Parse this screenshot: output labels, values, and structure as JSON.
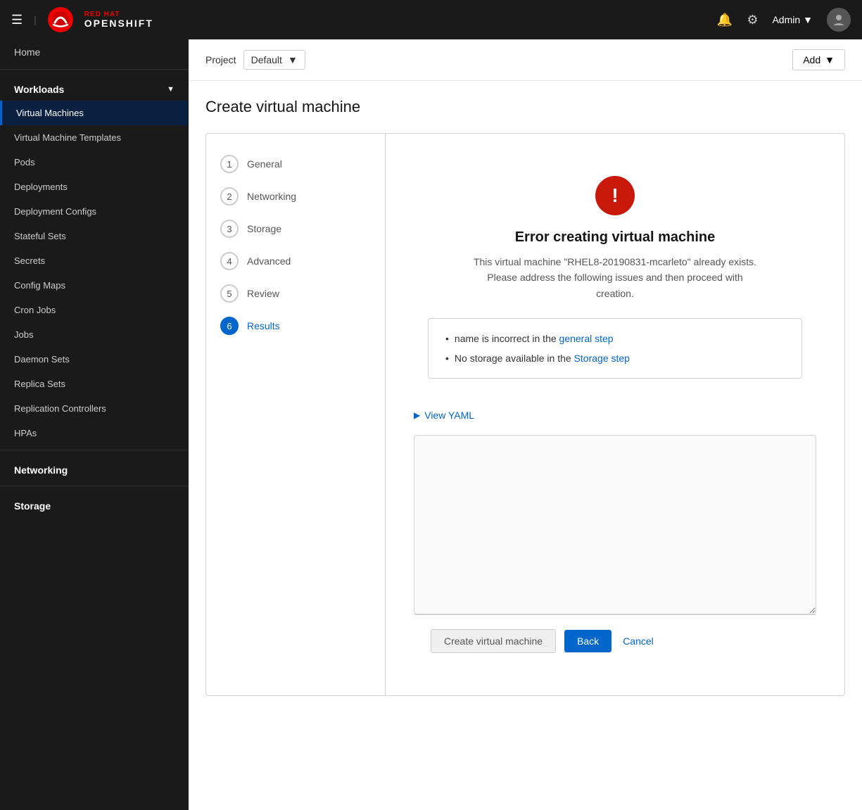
{
  "topNav": {
    "brandName": "OPENSHIFT",
    "adminLabel": "Admin",
    "notificationIcon": "🔔",
    "settingsIcon": "⚙"
  },
  "sidebar": {
    "homeLabel": "Home",
    "workloadsLabel": "Workloads",
    "networkingLabel": "Networking",
    "storageLabel": "Storage",
    "workloadsItems": [
      {
        "label": "Virtual Machines",
        "active": true
      },
      {
        "label": "Virtual Machine Templates",
        "active": false
      },
      {
        "label": "Pods",
        "active": false
      },
      {
        "label": "Deployments",
        "active": false
      },
      {
        "label": "Deployment Configs",
        "active": false
      },
      {
        "label": "Stateful Sets",
        "active": false
      },
      {
        "label": "Secrets",
        "active": false
      },
      {
        "label": "Config Maps",
        "active": false
      },
      {
        "label": "Cron Jobs",
        "active": false
      },
      {
        "label": "Jobs",
        "active": false
      },
      {
        "label": "Daemon Sets",
        "active": false
      },
      {
        "label": "Replica Sets",
        "active": false
      },
      {
        "label": "Replication Controllers",
        "active": false
      },
      {
        "label": "HPAs",
        "active": false
      }
    ]
  },
  "topBar": {
    "projectLabel": "Project",
    "projectValue": "Default",
    "addLabel": "Add"
  },
  "page": {
    "title": "Create virtual machine"
  },
  "wizard": {
    "steps": [
      {
        "number": "1",
        "label": "General",
        "active": false
      },
      {
        "number": "2",
        "label": "Networking",
        "active": false
      },
      {
        "number": "3",
        "label": "Storage",
        "active": false
      },
      {
        "number": "4",
        "label": "Advanced",
        "active": false
      },
      {
        "number": "5",
        "label": "Review",
        "active": false
      },
      {
        "number": "6",
        "label": "Results",
        "active": true
      }
    ],
    "error": {
      "title": "Error creating virtual machine",
      "description": "This virtual machine \"RHEL8-20190831-mcarleto\" already exists. Please address the following issues and then proceed with creation.",
      "issues": [
        {
          "text": "name is incorrect in the ",
          "linkText": "general step",
          "linkHref": "#general"
        },
        {
          "text": "No storage available in the ",
          "linkText": "Storage step",
          "linkHref": "#storage"
        }
      ]
    },
    "viewYamlLabel": "View YAML",
    "footer": {
      "createLabel": "Create virtual machine",
      "backLabel": "Back",
      "cancelLabel": "Cancel"
    }
  }
}
